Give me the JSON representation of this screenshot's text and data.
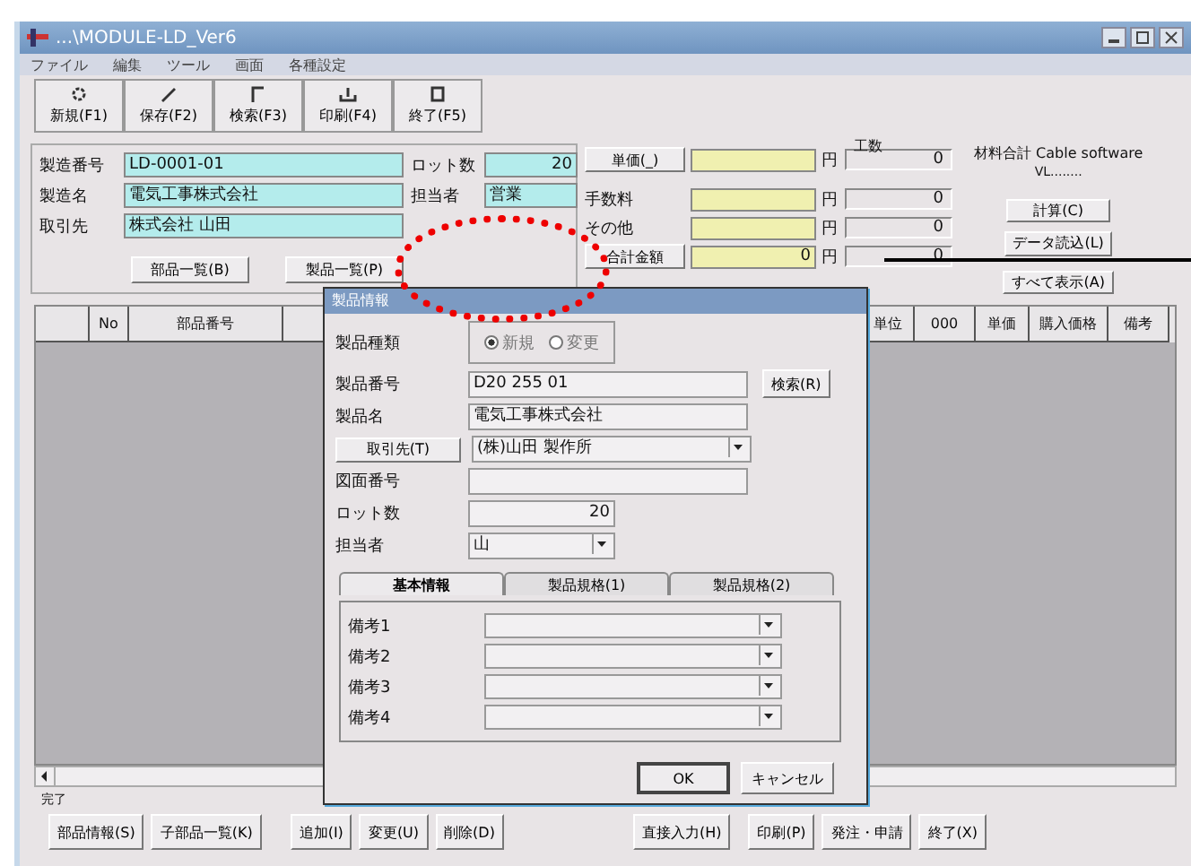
{
  "window": {
    "title": "...\\MODULE-LD_Ver6"
  },
  "menu": [
    "ファイル",
    "編集",
    "ツール",
    "画面",
    "各種設定"
  ],
  "toolbar": [
    "新規(F1)",
    "保存(F2)",
    "検索(F3)",
    "印刷(F4)",
    "終了(F5)"
  ],
  "header_fields": [
    {
      "label": "製造番号",
      "value": "LD-0001-01"
    },
    {
      "label": "製造名",
      "value": "電気工事株式会社"
    },
    {
      "label": "取引先",
      "value": "株式会社 山田"
    }
  ],
  "side_fields": [
    {
      "label": "ロット数",
      "value": "20"
    },
    {
      "label": "担当者",
      "value": "営業"
    }
  ],
  "header_buttons": [
    "部品一覧(B)",
    "製品一覧(P)"
  ],
  "cost_rows": [
    {
      "kind": "button",
      "label": "単価(_)",
      "value": "",
      "unit": "円",
      "total": "0"
    },
    {
      "kind": "label",
      "label": "手数料",
      "value": "",
      "unit": "円",
      "total": "0"
    },
    {
      "kind": "label",
      "label": "その他",
      "value": "",
      "unit": "円",
      "total": "0"
    },
    {
      "kind": "button",
      "label": "合計金額",
      "value": "0",
      "unit": "円",
      "total": "0"
    }
  ],
  "cost_caption": "工数",
  "summary": {
    "title": "材料合計 Cable software",
    "subtitle": "VL........"
  },
  "side_buttons": [
    "計算(C)",
    "データ読込(L)",
    "すべて表示(A)"
  ],
  "grid": {
    "columns": [
      "No",
      "部品番号",
      "単位",
      "000",
      "単価",
      "購入価格",
      "備考"
    ]
  },
  "status_text": "完了",
  "bottom_buttons": [
    "部品情報(S)",
    "子部品一覧(K)",
    "追加(I)",
    "変更(U)",
    "削除(D)",
    "直接入力(H)",
    "印刷(P)",
    "発注・申請",
    "終了(X)"
  ],
  "dialog": {
    "title": "製品情報",
    "type_label": "製品種類",
    "type_options": [
      {
        "label": "新規",
        "selected": true
      },
      {
        "label": "変更",
        "selected": false
      }
    ],
    "rows": [
      {
        "kind": "text",
        "label": "製品番号",
        "value": "D20 255 01",
        "action": "検索(R)"
      },
      {
        "kind": "text",
        "label": "製品名",
        "value": "電気工事株式会社"
      },
      {
        "kind": "lookup",
        "label": "取引先(T)",
        "value": "(株)山田 製作所"
      },
      {
        "kind": "text",
        "label": "図面番号",
        "value": ""
      },
      {
        "kind": "short",
        "label": "ロット数",
        "value": "20"
      },
      {
        "kind": "shortselect",
        "label": "担当者",
        "value": "山"
      }
    ],
    "tabs": [
      {
        "label": "基本情報",
        "selected": true
      },
      {
        "label": "製品規格(1)",
        "selected": false
      },
      {
        "label": "製品規格(2)",
        "selected": false
      }
    ],
    "notes": [
      "備考1",
      "備考2",
      "備考3",
      "備考4"
    ],
    "buttons": [
      "OK",
      "キャンセル"
    ]
  }
}
